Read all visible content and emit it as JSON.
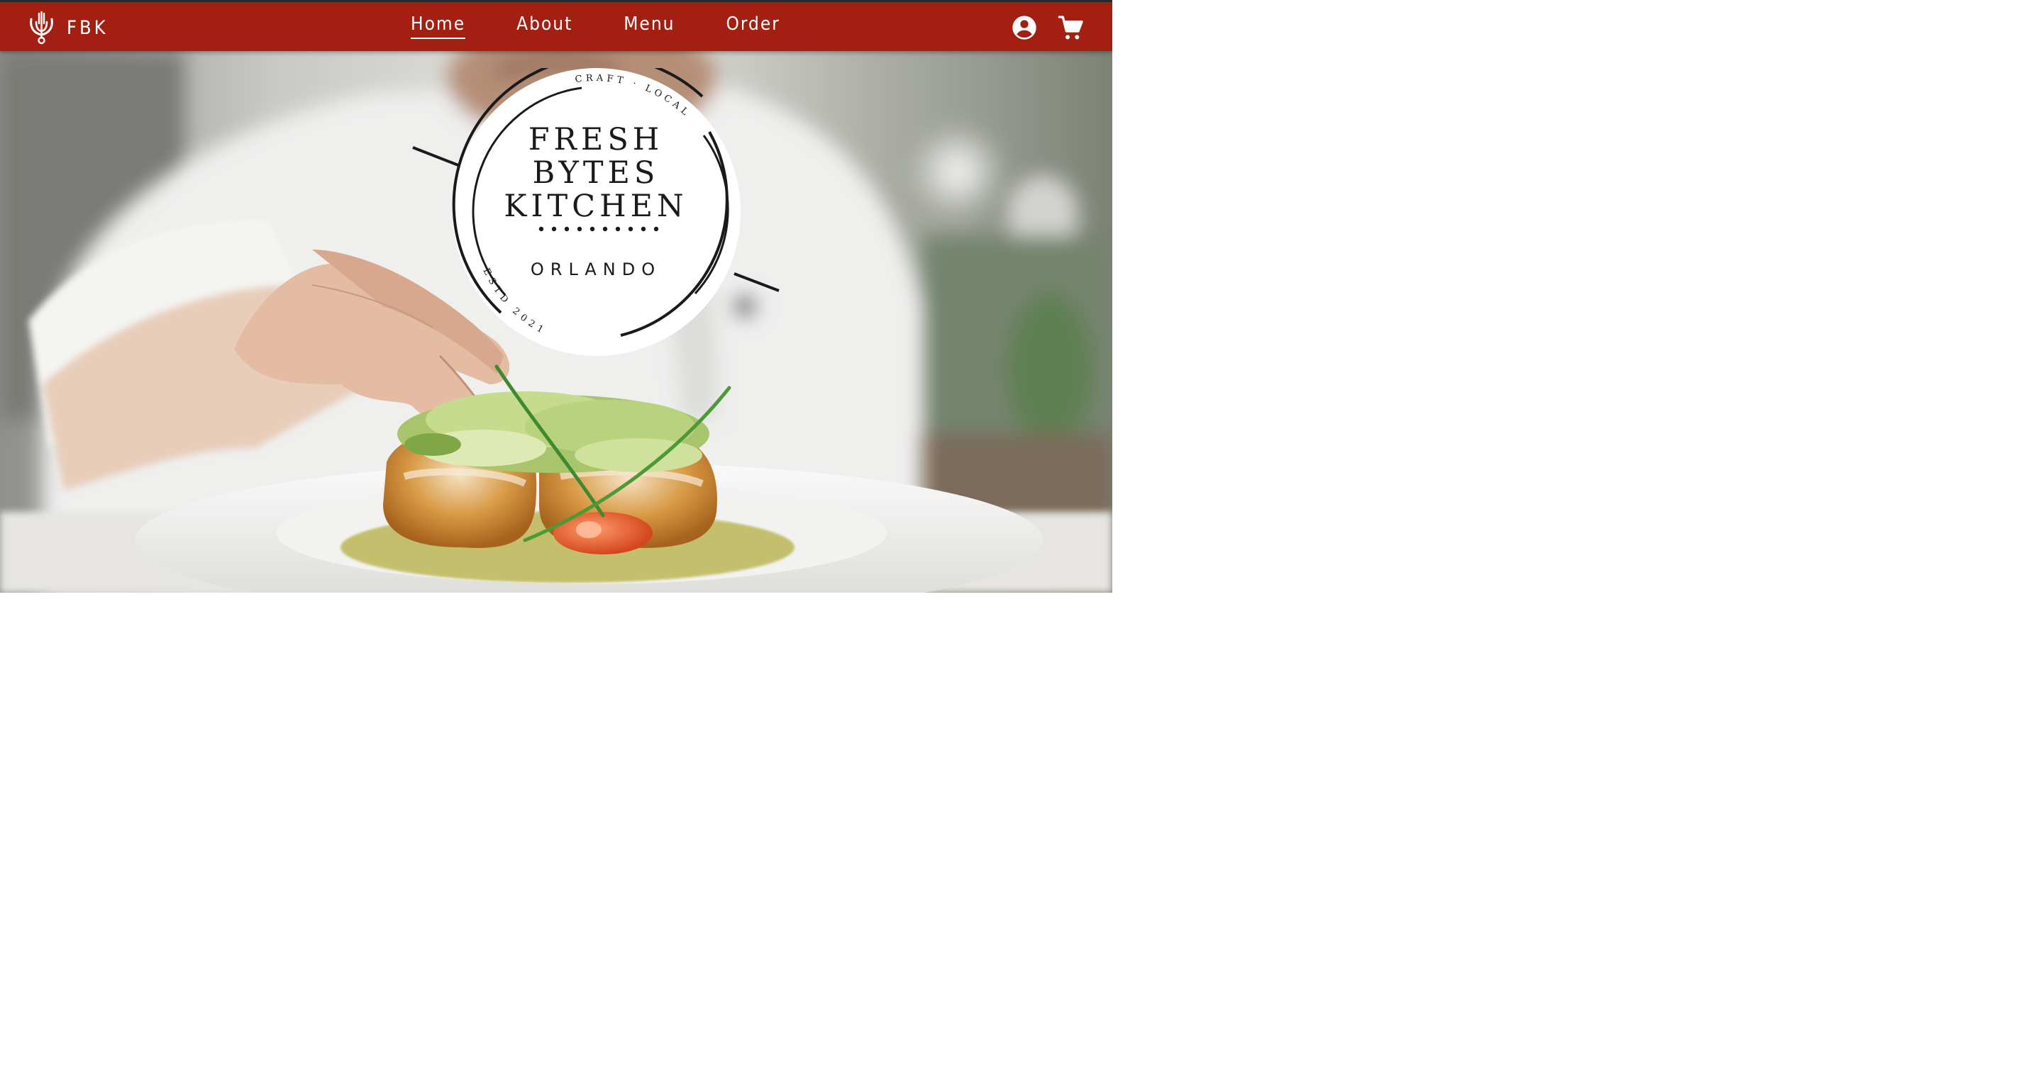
{
  "brand": {
    "name": "FBK",
    "logo_icon": "fork-utensil-logo-icon"
  },
  "nav": {
    "links": [
      {
        "label": "Home",
        "active": true
      },
      {
        "label": "About",
        "active": false
      },
      {
        "label": "Menu",
        "active": false
      },
      {
        "label": "Order",
        "active": false
      }
    ]
  },
  "icons": {
    "account": "account-circle-icon",
    "cart": "shopping-cart-icon"
  },
  "emblem": {
    "line1": "FRESH",
    "line2": "BYTES",
    "line3": "KITCHEN",
    "city": "ORLANDO",
    "arc_top": "CRAFT · LOCAL",
    "arc_bottom": "ESTD 2021"
  },
  "hero": {
    "image": "chef-plating-fish-photo"
  },
  "colors": {
    "navbar": "#a31f11",
    "text_on_navbar": "#ffffff",
    "emblem_ink": "#1a1a1a"
  }
}
